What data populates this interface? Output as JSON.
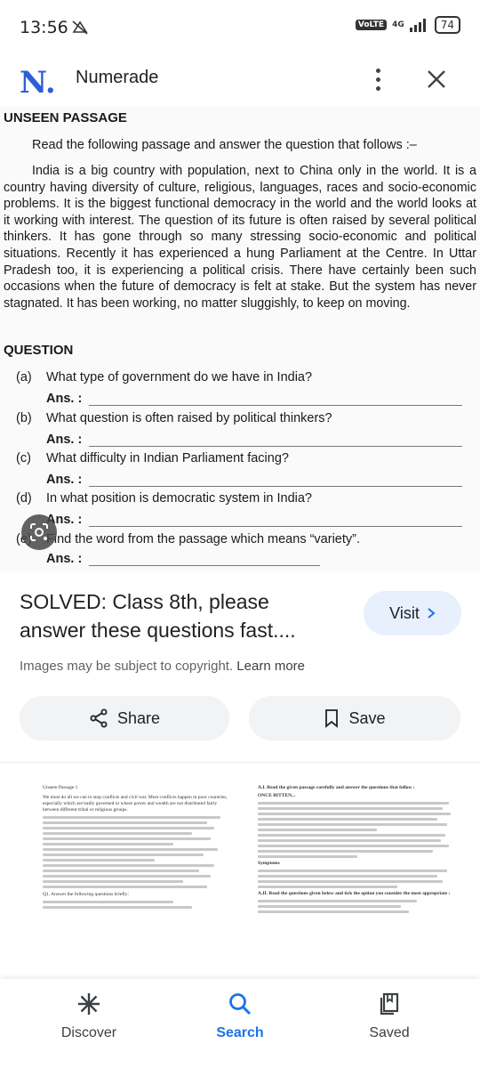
{
  "status_bar": {
    "time": "13:56",
    "network": "4G",
    "volte": "VoLTE",
    "battery": "74"
  },
  "app_bar": {
    "site_name": "Numerade",
    "logo_text": "N."
  },
  "document": {
    "heading": "UNSEEN PASSAGE",
    "instruction": "Read the following passage and answer the question that follows :–",
    "paragraph": "India is a big country with population, next to China only in the world. It is a country having diversity of culture, religious, languages, races and socio-economic problems. It is the biggest functional democracy in the world and the world looks at it working with interest. The question of its future is often raised by several political thinkers. It has gone through so many stressing socio-economic and political situations. Recently it has experienced a hung Parliament at the Centre. In Uttar Pradesh too, it is experiencing a political crisis. There have certainly been such occasions when the future of democracy is felt at stake. But the system has never stagnated. It has been working, no matter sluggishly, to keep on moving.",
    "question_heading": "QUESTION",
    "answer_label": "Ans. :",
    "questions": [
      {
        "letter": "(a)",
        "text": "What type of government do we have in India?"
      },
      {
        "letter": "(b)",
        "text": "What question is often raised by political thinkers?"
      },
      {
        "letter": "(c)",
        "text": "What difficulty in Indian Parliament facing?"
      },
      {
        "letter": "(d)",
        "text": "In what position is democratic system in India?"
      },
      {
        "letter": "(e)",
        "text": "Find the word from the passage which means “variety”."
      }
    ]
  },
  "result": {
    "title": "SOLVED: Class 8th, please answer these questions fast....",
    "visit_label": "Visit",
    "copyright_text": "Images may be subject to copyright.",
    "learn_more": "Learn more"
  },
  "actions": {
    "share_label": "Share",
    "save_label": "Save"
  },
  "related": {
    "left_heading": "Unseen Passage 1",
    "left_text": "We must do all we can to stop conflicts and civil war. Most conflicts happen in poor countries, especially which are badly governed or where power and wealth are not distributed fairly between different tribal or religious groups.",
    "left_question": "Q1. Answer the following questions briefly:",
    "right_heading": "A.I. Read the given passage carefully and answer the questions that follow :",
    "right_subheading": "ONCE BITTEN...",
    "right_symptoms": "Symptoms",
    "right_heading2": "A.II. Read the questions given below and tick the option you consider the most appropriate :"
  },
  "bottom_nav": {
    "items": [
      {
        "label": "Discover"
      },
      {
        "label": "Search"
      },
      {
        "label": "Saved"
      }
    ]
  },
  "colors": {
    "accent": "#1a73e8",
    "logo_blue": "#2b5fd9",
    "visit_bg": "#e8f0fe",
    "chip_bg": "#f1f3f4"
  }
}
